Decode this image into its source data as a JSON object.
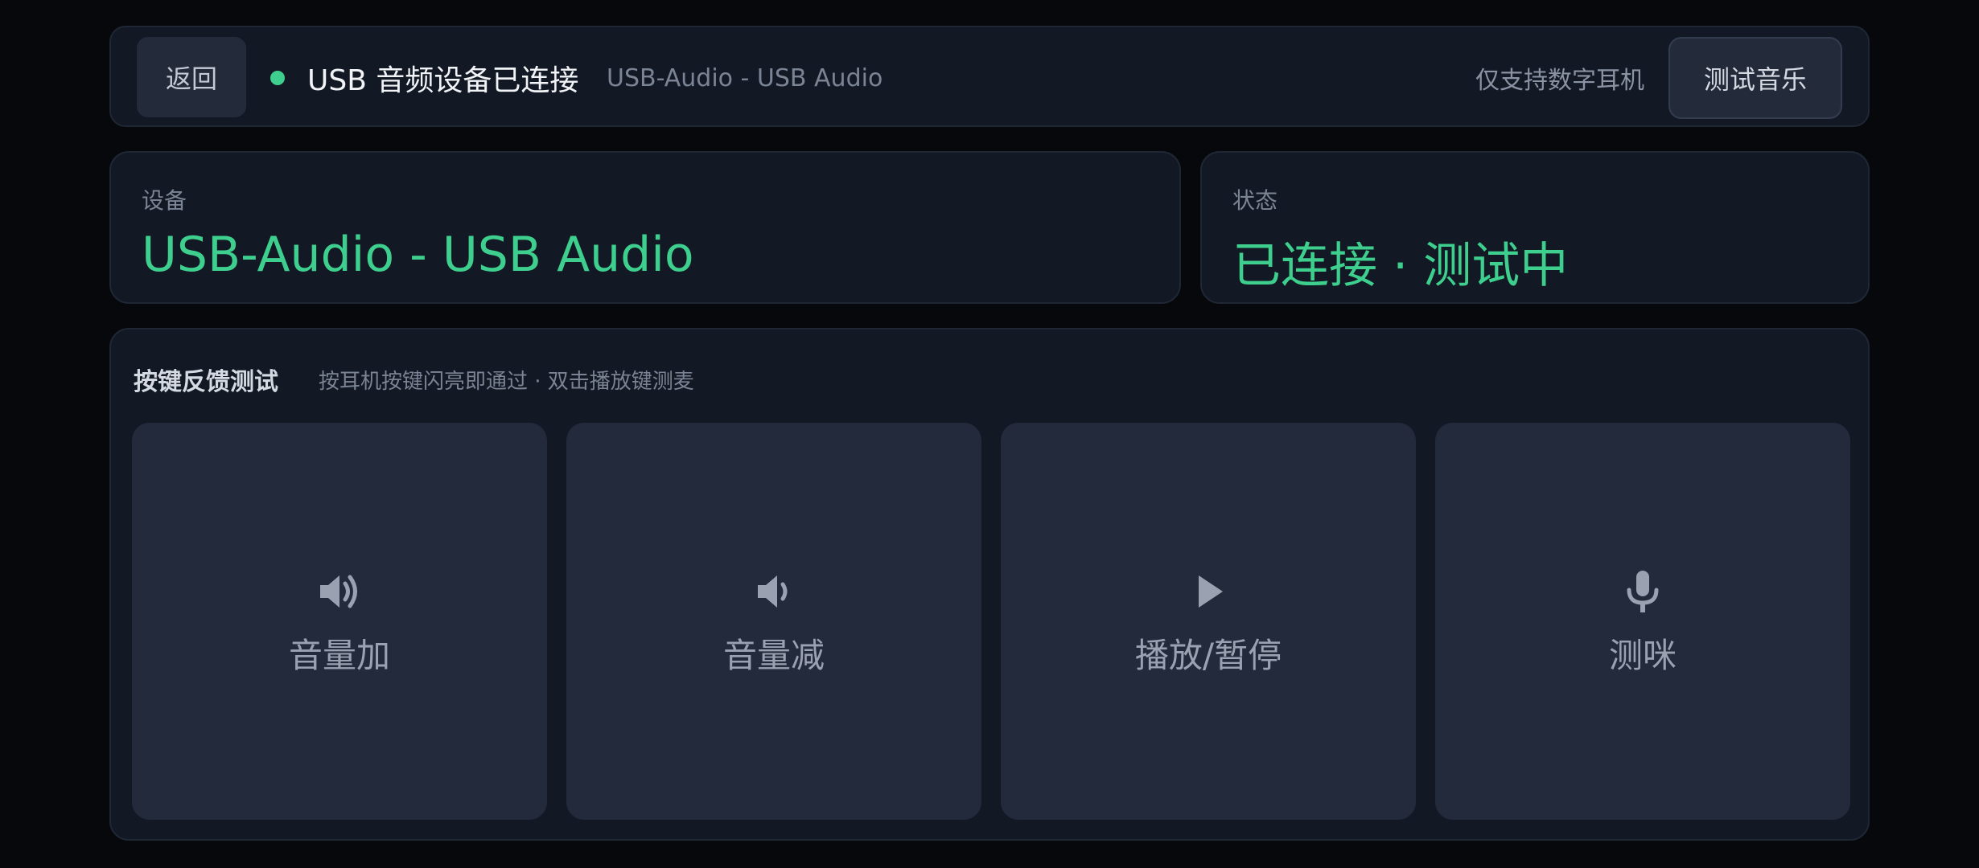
{
  "topbar": {
    "back_label": "返回",
    "connection_title": "USB 音频设备已连接",
    "connection_subtitle": "USB-Audio - USB Audio",
    "notice": "仅支持数字耳机",
    "test_music_label": "测试音乐",
    "status_color": "#3ecf8e"
  },
  "device_card": {
    "label": "设备",
    "value": "USB-Audio - USB Audio"
  },
  "status_card": {
    "label": "状态",
    "value": "已连接 · 测试中"
  },
  "keys_panel": {
    "title": "按键反馈测试",
    "hint": "按耳机按键闪亮即通过 · 双击播放键测麦",
    "keys": [
      {
        "label": "音量加",
        "icon": "volume-up-icon"
      },
      {
        "label": "音量减",
        "icon": "volume-down-icon"
      },
      {
        "label": "播放/暂停",
        "icon": "play-icon"
      },
      {
        "label": "测咪",
        "icon": "microphone-icon"
      }
    ]
  },
  "colors": {
    "accent": "#3ecf8e",
    "background": "#06080c",
    "panel": "#121824",
    "tile": "#232a3b"
  }
}
